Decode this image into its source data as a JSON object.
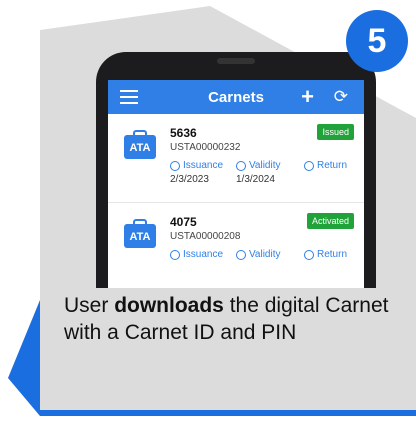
{
  "step": {
    "number": "5"
  },
  "app": {
    "title": "Carnets",
    "add_label": "+",
    "sync_label": "⟳"
  },
  "carnets": [
    {
      "number": "5636",
      "code": "USTA00000232",
      "status": "Issued",
      "issuance_label": "Issuance",
      "validity_label": "Validity",
      "return_label": "Return",
      "issuance_date": "2/3/2023",
      "validity_date": "1/3/2024"
    },
    {
      "number": "4075",
      "code": "USTA00000208",
      "status": "Activated",
      "issuance_label": "Issuance",
      "validity_label": "Validity",
      "return_label": "Return"
    }
  ],
  "caption": {
    "prefix": "User ",
    "bold": "downloads",
    "suffix": " the digital Carnet with a Carnet ID and PIN"
  },
  "colors": {
    "accent_blue": "#2f7fe6",
    "step_blue": "#1a6ee0",
    "badge_green": "#22a33a",
    "panel_gray": "#dcdcdc"
  }
}
